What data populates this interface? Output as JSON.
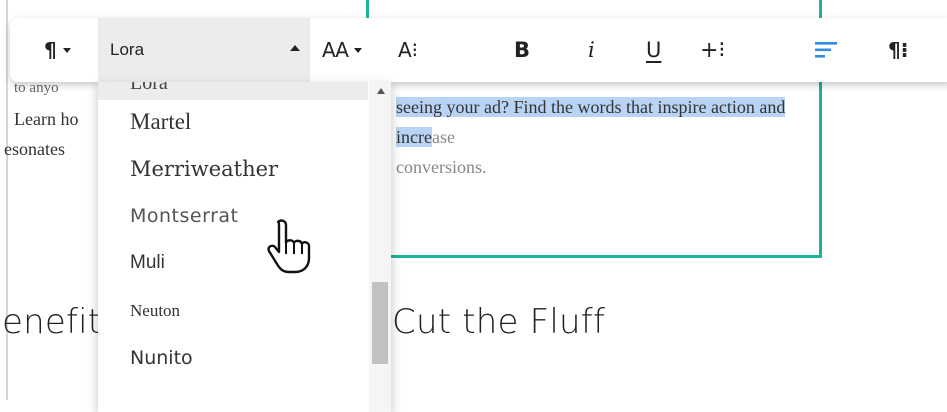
{
  "background": {
    "left_lines": [
      "to anyo",
      "Learn ho",
      "esonates"
    ],
    "box_paragraph": {
      "selected": "seeing your ad? Find the words that inspire action and incre",
      "rest": "ase",
      "line3": "conversions."
    },
    "heading_left": "enefit",
    "heading_right": "Cut the Fluff"
  },
  "toolbar": {
    "paragraph_symbol": "¶",
    "font_value": "Lora",
    "font_size_label": "AA",
    "text_height_label": "A⁝",
    "bold_label": "B",
    "italic_label": "i",
    "underline_label": "U",
    "more_label": "+⁝",
    "paragraph_spacing_label": "¶⁝"
  },
  "dropdown": {
    "partial_top": "Lora",
    "items": [
      {
        "label": "Martel"
      },
      {
        "label": "Merriweather"
      },
      {
        "label": "Montserrat"
      },
      {
        "label": "Muli"
      },
      {
        "label": "Neuton"
      },
      {
        "label": "Nunito"
      }
    ]
  },
  "colors": {
    "accent_green": "#1bb39b",
    "selection_blue": "#b9d3f4",
    "align_blue": "#2f8de4"
  }
}
